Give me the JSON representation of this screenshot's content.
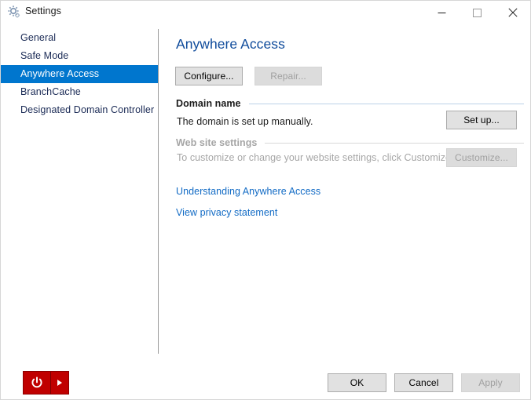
{
  "window": {
    "title": "Settings",
    "icon": "settings-gear-icon",
    "controls": {
      "minimize": "minimize-icon",
      "maximize": "maximize-icon",
      "close": "close-icon"
    }
  },
  "sidebar": {
    "items": [
      {
        "label": "General",
        "selected": false
      },
      {
        "label": "Safe Mode",
        "selected": false
      },
      {
        "label": "Anywhere Access",
        "selected": true
      },
      {
        "label": "BranchCache",
        "selected": false
      },
      {
        "label": "Designated Domain Controller",
        "selected": false
      }
    ]
  },
  "content": {
    "page_title": "Anywhere Access",
    "top_buttons": {
      "configure": "Configure...",
      "repair": "Repair..."
    },
    "sections": [
      {
        "header": "Domain name",
        "description": "The domain is set up manually.",
        "action": "Set up...",
        "enabled": true
      },
      {
        "header": "Web site settings",
        "description": "To customize or change your website settings, click Customize.",
        "action": "Customize...",
        "enabled": false
      }
    ],
    "links": [
      "Understanding Anywhere Access",
      "View privacy statement"
    ]
  },
  "footer": {
    "power_button": "power-icon",
    "power_dropdown": "caret-right-icon",
    "ok": "OK",
    "cancel": "Cancel",
    "apply": "Apply"
  },
  "colors": {
    "accent": "#0076ce",
    "title_blue": "#0f4b9b",
    "link_blue": "#126bc5",
    "power_red": "#c00000",
    "disabled_gray": "#a6a6a6"
  }
}
